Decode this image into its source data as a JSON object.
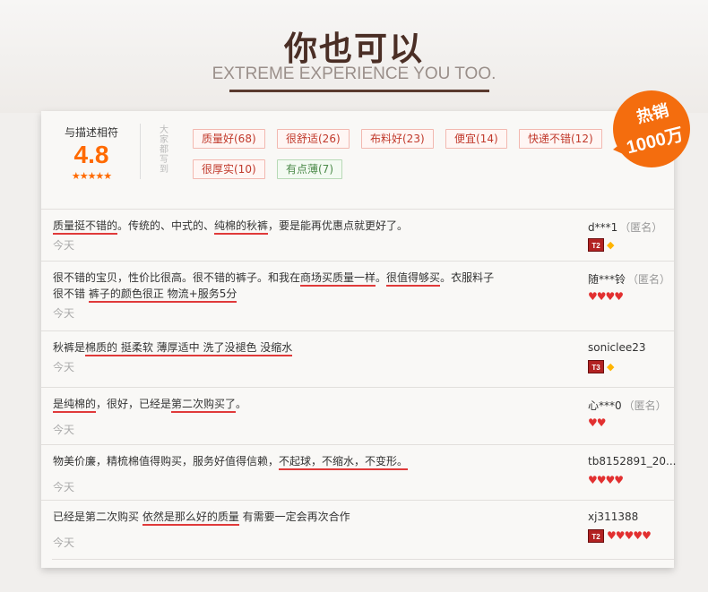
{
  "header": {
    "title": "你也可以",
    "subtitle": "EXTREME EXPERIENCE YOU TOO."
  },
  "score": {
    "label": "与描述相符",
    "value": "4.8",
    "stars": "★★★★★"
  },
  "vertical_note": "大家都写到",
  "tags": [
    {
      "label": "质量好(68)",
      "kind": "positive"
    },
    {
      "label": "很舒适(26)",
      "kind": "positive"
    },
    {
      "label": "布料好(23)",
      "kind": "positive"
    },
    {
      "label": "便宜(14)",
      "kind": "positive"
    },
    {
      "label": "快递不错(12)",
      "kind": "positive"
    },
    {
      "label": "很厚实(10)",
      "kind": "positive"
    },
    {
      "label": "有点薄(7)",
      "kind": "neutral"
    }
  ],
  "badge": {
    "line1": "热销",
    "line2": "1000万"
  },
  "reviews": [
    {
      "parts": [
        {
          "text": "质量挺不错的",
          "hl": true
        },
        {
          "text": "。传统的、中式的、",
          "hl": false
        },
        {
          "text": "纯棉的秋裤",
          "hl": true
        },
        {
          "text": "，要是能再优惠点就更好了。",
          "hl": false
        }
      ],
      "line2": [],
      "time": "今天",
      "user": "d***1",
      "anon": "（匿名）",
      "level": "T2",
      "gem": true,
      "hearts": 0
    },
    {
      "parts": [
        {
          "text": "很不错的宝贝，性价比很高。很不错的裤子。和我在",
          "hl": false
        },
        {
          "text": "商场买质量一样",
          "hl": true
        },
        {
          "text": "。",
          "hl": false
        },
        {
          "text": "很值得够买",
          "hl": true
        },
        {
          "text": "。衣服料子",
          "hl": false
        }
      ],
      "line2": [
        {
          "text": "很不错  ",
          "hl": false
        },
        {
          "text": "裤子的颜色很正 物流+服务5分",
          "hl": true
        }
      ],
      "time": "今天",
      "user": "随***铃",
      "anon": "（匿名）",
      "level": "",
      "gem": false,
      "hearts": 4
    },
    {
      "parts": [
        {
          "text": "秋裤是",
          "hl": false
        },
        {
          "text": "棉质的 挺柔软 薄厚适中 洗了没褪色 没缩水",
          "hl": true
        }
      ],
      "line2": [],
      "time": "今天",
      "user": "soniclee23",
      "anon": "",
      "level": "T3",
      "gem": true,
      "hearts": 0
    },
    {
      "parts": [
        {
          "text": "是纯棉的",
          "hl": true
        },
        {
          "text": "，很好，已经是",
          "hl": false
        },
        {
          "text": "第二次购买了",
          "hl": true
        },
        {
          "text": "。",
          "hl": false
        }
      ],
      "line2": [],
      "time": "今天",
      "user": "心***0",
      "anon": "（匿名）",
      "level": "",
      "gem": false,
      "hearts": 2
    },
    {
      "parts": [
        {
          "text": "物美价廉，精梳棉值得购买，服务好值得信赖，",
          "hl": false
        },
        {
          "text": "不起球，不缩水，不变形。",
          "hl": true
        }
      ],
      "line2": [],
      "time": "今天",
      "user": "tb8152891_20...",
      "anon": "",
      "level": "",
      "gem": false,
      "hearts": 4
    },
    {
      "parts": [
        {
          "text": "已经是第二次购买 ",
          "hl": false
        },
        {
          "text": "依然是那么好的质量",
          "hl": true
        },
        {
          "text": " 有需要一定会再次合作",
          "hl": false
        }
      ],
      "line2": [],
      "time": "今天",
      "user": "xj311388",
      "anon": "",
      "level": "T2",
      "gem": false,
      "hearts": 5
    }
  ]
}
